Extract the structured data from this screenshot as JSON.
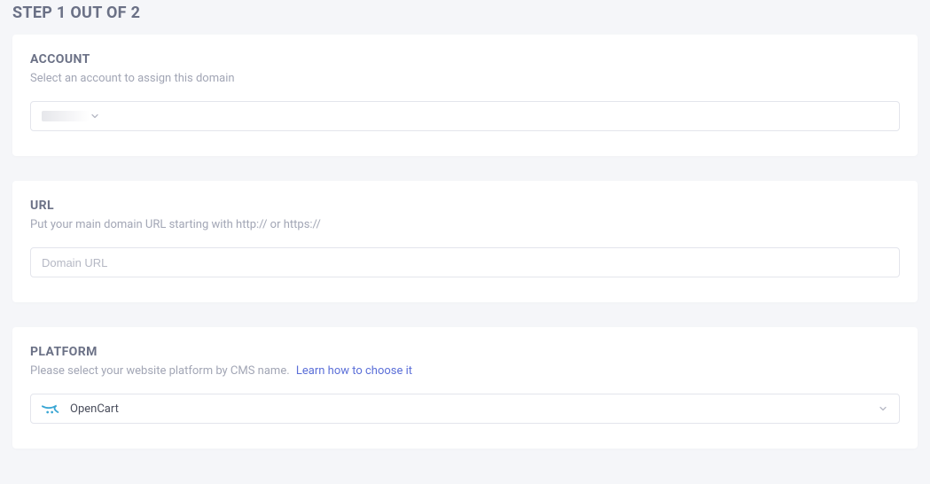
{
  "step": {
    "title": "STEP 1 OUT OF 2"
  },
  "account": {
    "heading": "ACCOUNT",
    "description": "Select an account to assign this domain",
    "selected": ""
  },
  "url": {
    "heading": "URL",
    "description": "Put your main domain URL starting with http:// or https://",
    "placeholder": "Domain URL",
    "value": ""
  },
  "platform": {
    "heading": "PLATFORM",
    "description": "Please select your website platform by CMS name.",
    "learn_link": "Learn how to choose it",
    "selected": "OpenCart"
  }
}
